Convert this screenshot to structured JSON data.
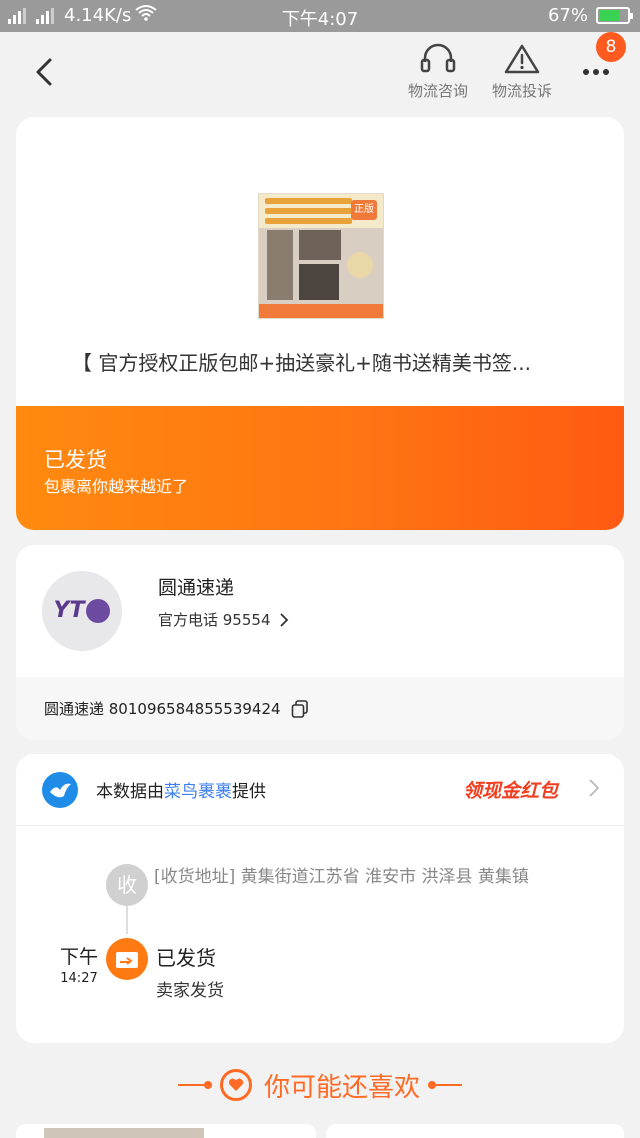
{
  "status_bar": {
    "net_speed": "4.14K/s",
    "time": "下午4:07",
    "battery": "67%",
    "battery_level": 0.67
  },
  "header": {
    "actions": [
      {
        "label": "物流咨询",
        "icon": "headset-icon"
      },
      {
        "label": "物流投诉",
        "icon": "warning-icon"
      }
    ],
    "more_badge": "8"
  },
  "product": {
    "title": "【 官方授权正版包邮+抽送豪礼+随书送精美书签...",
    "thumb_tag": "正版"
  },
  "shipment": {
    "status": "已发货",
    "desc": "包裹离你越来越近了"
  },
  "courier": {
    "logo_text": "YT",
    "name": "圆通速递",
    "phone_label": "官方电话 95554",
    "tracking": "圆通速递 801096584855539424"
  },
  "tracking_card": {
    "source_prefix": "本数据由",
    "source_name": "菜鸟裹裹",
    "source_suffix": "提供",
    "promo": "领现金红包",
    "receive_node": "收",
    "receive_address": "[收货地址]   黄集街道江苏省 淮安市 洪泽县 黄集镇",
    "event": {
      "day": "下午",
      "time": "14:27",
      "title": "已发货",
      "desc": "卖家发货"
    }
  },
  "recommend": {
    "title": "你可能还喜欢"
  },
  "colors": {
    "accent": "#ff7513",
    "link_blue": "#3d7ff0",
    "promo_red": "#ef3e20"
  }
}
